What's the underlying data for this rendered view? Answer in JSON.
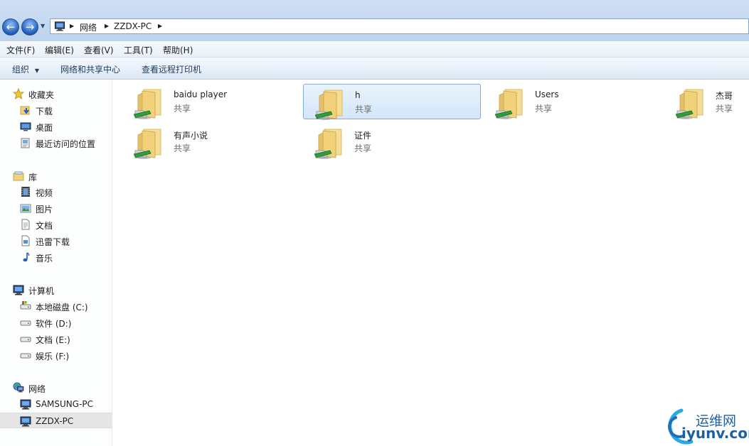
{
  "address": {
    "crumbs": [
      "网络",
      "ZZDX-PC"
    ]
  },
  "menu": {
    "items": [
      "文件(F)",
      "编辑(E)",
      "查看(V)",
      "工具(T)",
      "帮助(H)"
    ]
  },
  "commands": {
    "organize": "组织",
    "network_center": "网络和共享中心",
    "remote_printers": "查看远程打印机"
  },
  "nav": {
    "favorites": {
      "title": "收藏夹",
      "items": [
        "下载",
        "桌面",
        "最近访问的位置"
      ]
    },
    "libraries": {
      "title": "库",
      "items": [
        "视频",
        "图片",
        "文档",
        "迅雷下载",
        "音乐"
      ]
    },
    "computer": {
      "title": "计算机",
      "items": [
        "本地磁盘 (C:)",
        "软件 (D:)",
        "文档 (E:)",
        "娱乐 (F:)"
      ]
    },
    "network": {
      "title": "网络",
      "items": [
        "SAMSUNG-PC",
        "ZZDX-PC"
      ],
      "selected": "ZZDX-PC"
    }
  },
  "shares": [
    {
      "name": "baidu player",
      "sub": "共享"
    },
    {
      "name": "h",
      "sub": "共享",
      "selected": true
    },
    {
      "name": "Users",
      "sub": "共享"
    },
    {
      "name": "杰哥",
      "sub": "共享"
    },
    {
      "name": "有声小说",
      "sub": "共享"
    },
    {
      "name": "证件",
      "sub": "共享"
    }
  ],
  "watermark": {
    "cn": "运维网",
    "en": "iyunv.com"
  },
  "colors": {
    "accent": "#84acdd",
    "selection": "#d3e6fb",
    "folder": "#f1d27a",
    "share_badge": "#2e9e3b"
  }
}
